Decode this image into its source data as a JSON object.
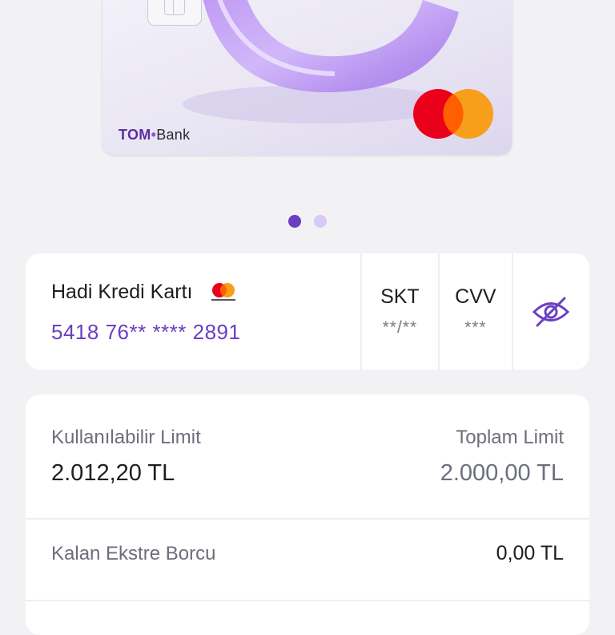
{
  "card_visual": {
    "bank_name_part1": "TOM",
    "bank_name_dot": "•",
    "bank_name_part2": "Bank",
    "network_logo": "mastercard-logo"
  },
  "pager": {
    "total": 2,
    "active_index": 0
  },
  "card_info": {
    "name": "Hadi Kredi Kartı",
    "number": "5418 76** **** 2891",
    "expiry_label": "SKT",
    "expiry_value": "**/**",
    "cvv_label": "CVV",
    "cvv_value": "***",
    "toggle_icon": "eye-off-icon"
  },
  "limits": {
    "available_label": "Kullanılabilir Limit",
    "available_value": "2.012,20 TL",
    "total_label": "Toplam Limit",
    "total_value": "2.000,00 TL",
    "statement_label": "Kalan Ekstre Borcu",
    "statement_value": "0,00 TL"
  },
  "colors": {
    "accent": "#6a3fc2",
    "background": "#f2f2f5",
    "mastercard_red": "#eb001b",
    "mastercard_orange": "#f79e1b"
  }
}
